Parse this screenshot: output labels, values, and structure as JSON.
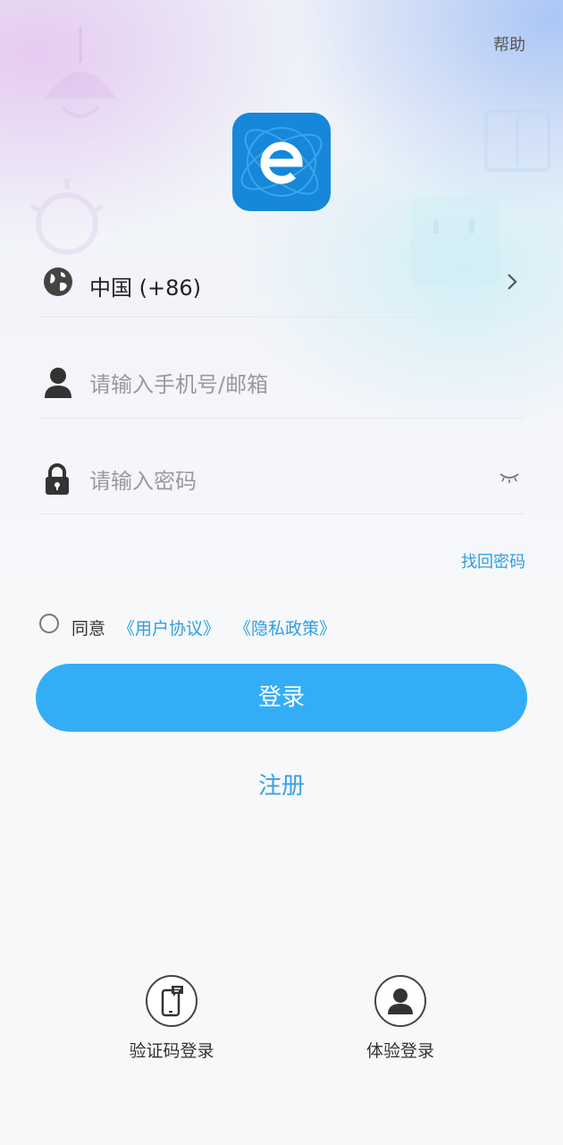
{
  "header": {
    "help_label": "帮助"
  },
  "logo": {
    "icon": "app-logo-e"
  },
  "country": {
    "label": "中国 (+86)",
    "icon": "globe-icon"
  },
  "phone": {
    "placeholder": "请输入手机号/邮箱",
    "value": "",
    "icon": "user-icon"
  },
  "password": {
    "placeholder": "请输入密码",
    "value": "",
    "icon": "lock-icon"
  },
  "forgot": {
    "label": "找回密码"
  },
  "agreement": {
    "agree_label": "同意",
    "terms_label": "《用户协议》",
    "privacy_label": "《隐私政策》",
    "checked": false
  },
  "login": {
    "label": "登录"
  },
  "register": {
    "label": "注册"
  },
  "alt_login": [
    {
      "label": "验证码登录",
      "icon": "phone-sms-icon"
    },
    {
      "label": "体验登录",
      "icon": "user-icon"
    }
  ],
  "colors": {
    "accent": "#33aef6",
    "link": "#2f9fe0",
    "logo": "#1687d9"
  }
}
